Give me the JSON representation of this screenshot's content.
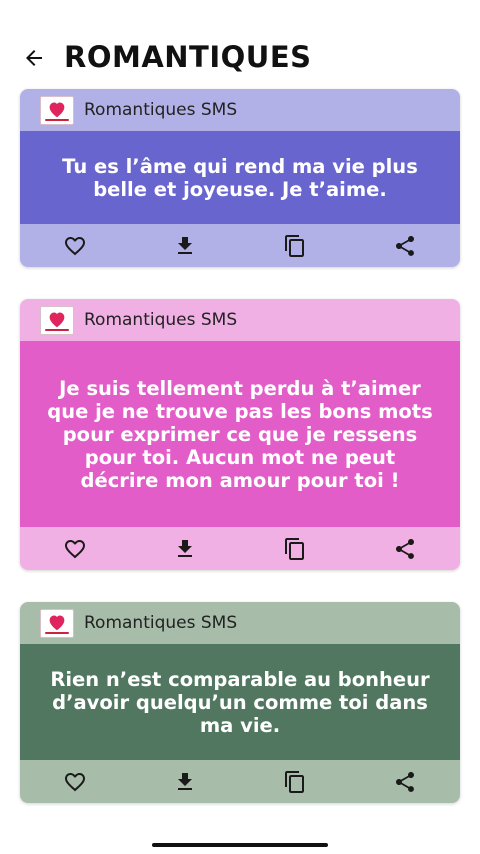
{
  "header": {
    "title": "ROMANTIQUES",
    "back_icon": "arrow-left-icon"
  },
  "cards": [
    {
      "app_name": "Romantiques SMS",
      "message": "Tu es l’âme qui rend ma vie plus belle et joyeuse. Je t’aime.",
      "colors": {
        "header": "#b1b1e8",
        "body": "#6865cf",
        "actions": "#b1b1e8"
      }
    },
    {
      "app_name": "Romantiques SMS",
      "message": "Je suis tellement perdu à t’aimer que je ne trouve pas les bons mots pour exprimer ce que je ressens pour toi. Aucun mot ne peut décrire mon amour pour toi !",
      "colors": {
        "header": "#f0b0e4",
        "body": "#e35dc8",
        "actions": "#f0b0e4"
      }
    },
    {
      "app_name": "Romantiques SMS",
      "message": "Rien n’est comparable au bonheur d’avoir quelqu’un comme toi dans ma vie.",
      "colors": {
        "header": "#a8bcaa",
        "body": "#527760",
        "actions": "#a8bcaa"
      }
    }
  ],
  "action_icons": [
    "heart-outline-icon",
    "download-icon",
    "copy-icon",
    "share-icon"
  ],
  "accent_colors": {
    "logo_heart": "#e0245e",
    "icon": "#1a1a1a"
  }
}
